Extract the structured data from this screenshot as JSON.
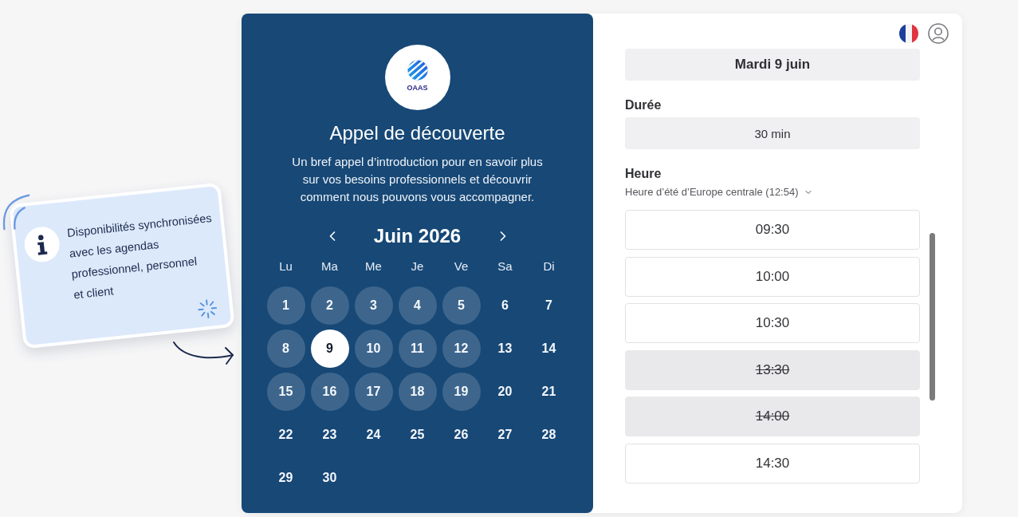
{
  "callout": {
    "text": "Disponibilités synchronisées\navec les agendas\nprofessionnel, personnel\net client"
  },
  "event": {
    "logo_text": "OAAS",
    "title": "Appel de découverte",
    "description": "Un bref appel d’introduction pour en savoir plus\nsur vos besoins professionnels et découvrir\ncomment nous pouvons vous accompagner."
  },
  "calendar": {
    "month": "Juin 2026",
    "weekdays": [
      "Lu",
      "Ma",
      "Me",
      "Je",
      "Ve",
      "Sa",
      "Di"
    ],
    "days": [
      {
        "label": "1",
        "available": true,
        "selected": false
      },
      {
        "label": "2",
        "available": true,
        "selected": false
      },
      {
        "label": "3",
        "available": true,
        "selected": false
      },
      {
        "label": "4",
        "available": true,
        "selected": false
      },
      {
        "label": "5",
        "available": true,
        "selected": false
      },
      {
        "label": "6",
        "available": false,
        "selected": false
      },
      {
        "label": "7",
        "available": false,
        "selected": false
      },
      {
        "label": "8",
        "available": true,
        "selected": false
      },
      {
        "label": "9",
        "available": true,
        "selected": true
      },
      {
        "label": "10",
        "available": true,
        "selected": false
      },
      {
        "label": "11",
        "available": true,
        "selected": false
      },
      {
        "label": "12",
        "available": true,
        "selected": false
      },
      {
        "label": "13",
        "available": false,
        "selected": false
      },
      {
        "label": "14",
        "available": false,
        "selected": false
      },
      {
        "label": "15",
        "available": true,
        "selected": false
      },
      {
        "label": "16",
        "available": true,
        "selected": false
      },
      {
        "label": "17",
        "available": true,
        "selected": false
      },
      {
        "label": "18",
        "available": true,
        "selected": false
      },
      {
        "label": "19",
        "available": true,
        "selected": false
      },
      {
        "label": "20",
        "available": false,
        "selected": false
      },
      {
        "label": "21",
        "available": false,
        "selected": false
      },
      {
        "label": "22",
        "available": false,
        "selected": false
      },
      {
        "label": "23",
        "available": false,
        "selected": false
      },
      {
        "label": "24",
        "available": false,
        "selected": false
      },
      {
        "label": "25",
        "available": false,
        "selected": false
      },
      {
        "label": "26",
        "available": false,
        "selected": false
      },
      {
        "label": "27",
        "available": false,
        "selected": false
      },
      {
        "label": "28",
        "available": false,
        "selected": false
      },
      {
        "label": "29",
        "available": false,
        "selected": false
      },
      {
        "label": "30",
        "available": false,
        "selected": false
      }
    ]
  },
  "booking": {
    "selected_date": "Mardi 9 juin",
    "duration_label": "Durée",
    "duration": "30 min",
    "time_label": "Heure",
    "timezone": "Heure d’été d’Europe centrale (12:54)",
    "time_slots": [
      {
        "label": "09:30",
        "disabled": false
      },
      {
        "label": "10:00",
        "disabled": false
      },
      {
        "label": "10:30",
        "disabled": false
      },
      {
        "label": "13:30",
        "disabled": true
      },
      {
        "label": "14:00",
        "disabled": true
      },
      {
        "label": "14:30",
        "disabled": false
      }
    ]
  }
}
